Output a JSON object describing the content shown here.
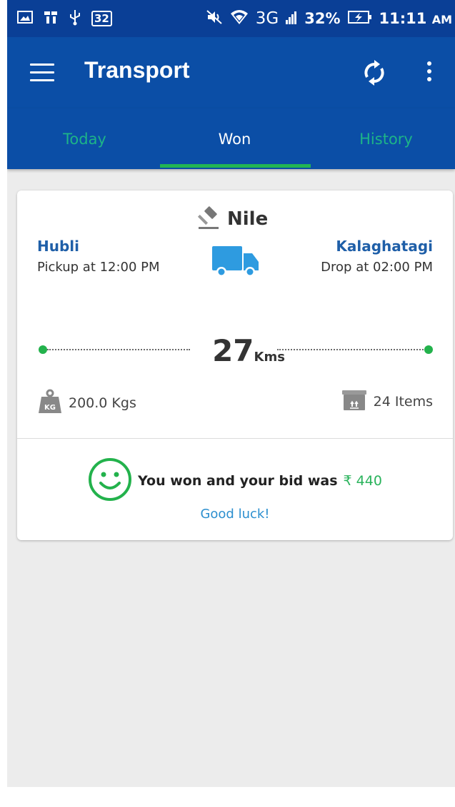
{
  "status_bar": {
    "badge": "32",
    "network": "3G",
    "battery": "32%",
    "time": "11:11",
    "ampm": "AM",
    "icons": [
      "gallery-icon",
      "app-icon",
      "usb-icon",
      "mute-icon",
      "wifi-icon",
      "signal-icon",
      "battery-charging-icon"
    ]
  },
  "app_bar": {
    "title": "Transport",
    "icons": [
      "menu-icon",
      "sync-icon",
      "more-vert-icon"
    ]
  },
  "tabs": [
    {
      "label": "Today",
      "selected": false
    },
    {
      "label": "Won",
      "selected": true
    },
    {
      "label": "History",
      "selected": false
    }
  ],
  "card": {
    "bidder": "Nile",
    "from": {
      "city": "Hubli",
      "time": "Pickup at 12:00 PM"
    },
    "to": {
      "city": "Kalaghatagi",
      "time": "Drop at 02:00 PM"
    },
    "distance": {
      "value": "27",
      "unit": "Kms"
    },
    "weight": {
      "badge": "KG",
      "text": "200.0 Kgs"
    },
    "items": {
      "text": "24 Items"
    },
    "result": {
      "message": "You won and your bid was",
      "amount": "₹ 440",
      "note": "Good luck!"
    }
  },
  "colors": {
    "status_bar": "#0a3f96",
    "app_bar": "#0b4ea6",
    "tab_inactive": "#1db488",
    "tab_indicator": "#22b552",
    "city": "#1f5fa8",
    "truck": "#2e9be0",
    "success": "#23b24c",
    "good_luck": "#2c8fcf",
    "background": "#ececec"
  }
}
